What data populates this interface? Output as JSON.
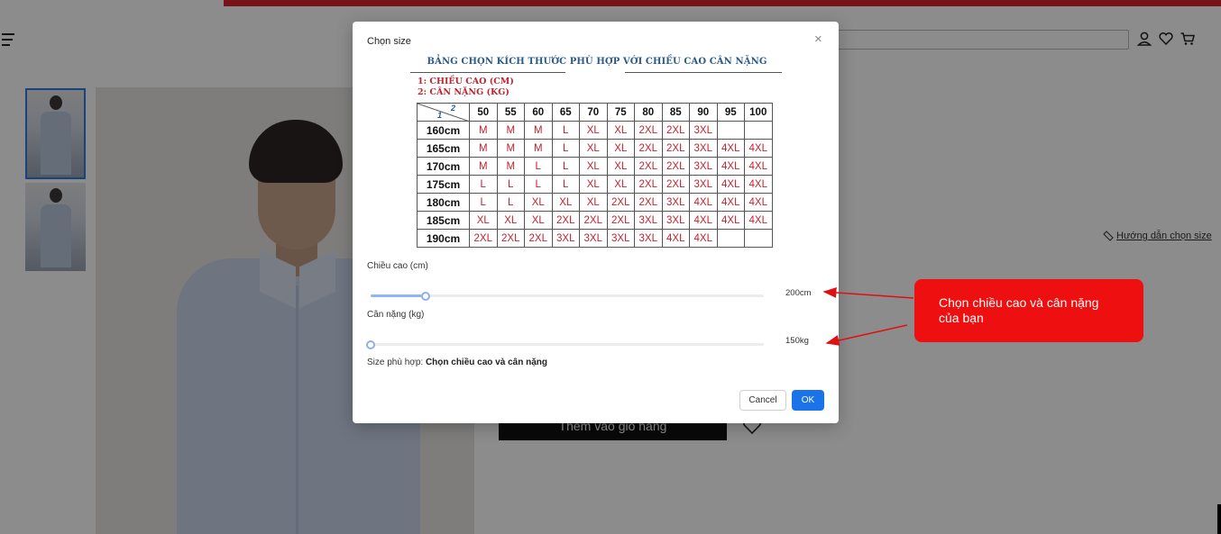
{
  "modal": {
    "title": "Chọn size",
    "close_icon": "×",
    "chart": {
      "title": "BẢNG CHỌN KÍCH THƯỚC PHÙ HỢP VỚI CHIỀU CAO CÂN NẶNG",
      "legend_1": "1: CHIỀU CAO (CM)",
      "legend_2": "2: CÂN NẶNG (KG)",
      "corner_1": "1",
      "corner_2": "2",
      "weights": [
        "50",
        "55",
        "60",
        "65",
        "70",
        "75",
        "80",
        "85",
        "90",
        "95",
        "100"
      ],
      "rows": [
        {
          "height": "160cm",
          "sizes": [
            "M",
            "M",
            "M",
            "L",
            "XL",
            "XL",
            "2XL",
            "2XL",
            "3XL",
            "",
            ""
          ]
        },
        {
          "height": "165cm",
          "sizes": [
            "M",
            "M",
            "M",
            "L",
            "XL",
            "XL",
            "2XL",
            "2XL",
            "3XL",
            "4XL",
            "4XL"
          ]
        },
        {
          "height": "170cm",
          "sizes": [
            "M",
            "M",
            "L",
            "L",
            "XL",
            "XL",
            "2XL",
            "2XL",
            "3XL",
            "4XL",
            "4XL"
          ]
        },
        {
          "height": "175cm",
          "sizes": [
            "L",
            "L",
            "L",
            "L",
            "XL",
            "XL",
            "2XL",
            "2XL",
            "3XL",
            "4XL",
            "4XL"
          ]
        },
        {
          "height": "180cm",
          "sizes": [
            "L",
            "L",
            "XL",
            "XL",
            "XL",
            "2XL",
            "2XL",
            "3XL",
            "4XL",
            "4XL",
            "4XL"
          ]
        },
        {
          "height": "185cm",
          "sizes": [
            "XL",
            "XL",
            "XL",
            "2XL",
            "2XL",
            "2XL",
            "3XL",
            "3XL",
            "4XL",
            "4XL",
            "4XL"
          ]
        },
        {
          "height": "190cm",
          "sizes": [
            "2XL",
            "2XL",
            "2XL",
            "3XL",
            "3XL",
            "3XL",
            "3XL",
            "4XL",
            "4XL",
            "",
            ""
          ]
        }
      ]
    },
    "height_slider": {
      "label": "Chiều cao (cm)",
      "max_label": "200cm",
      "value_fraction": 0.14
    },
    "weight_slider": {
      "label": "Cân nặng (kg)",
      "max_label": "150kg",
      "value_fraction": 0.0
    },
    "result_prefix": "Size phù hợp: ",
    "result_value": "Chọn chiều cao và cân nặng",
    "cancel_label": "Cancel",
    "ok_label": "OK"
  },
  "background": {
    "size_guide_link": "Hướng dẫn chọn size",
    "add_to_cart_label": "Thêm vào giỏ hàng"
  },
  "annotation": {
    "callout_text": "Chọn chiều cao và cân nặng của bạn"
  },
  "colors": {
    "accent_blue": "#1a73e8",
    "chart_red": "#c0232f",
    "callout_red": "#ee1010",
    "top_bar_red": "#d9232d"
  }
}
